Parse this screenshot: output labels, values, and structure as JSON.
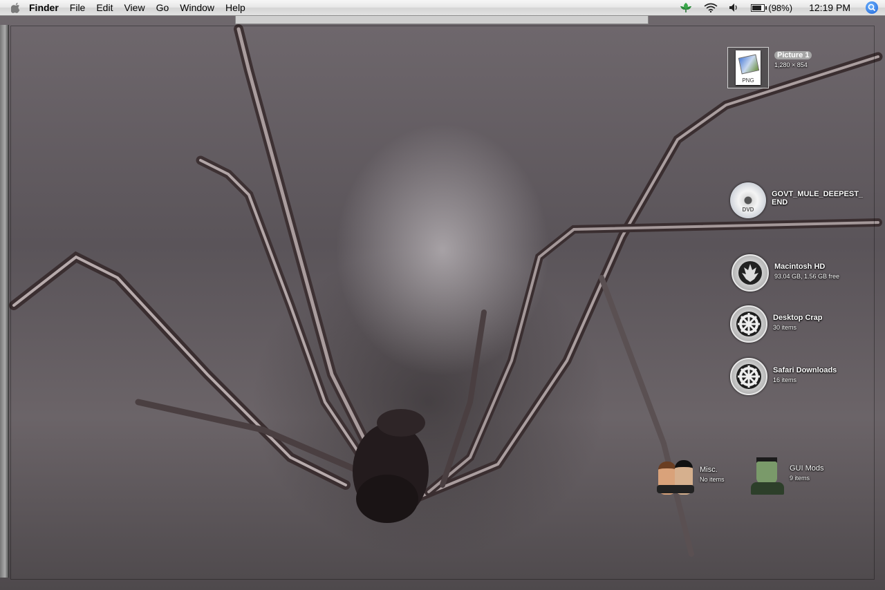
{
  "menubar": {
    "app_name": "Finder",
    "menus": [
      "File",
      "Edit",
      "View",
      "Go",
      "Window",
      "Help"
    ],
    "battery_text": "(98%)",
    "clock": "12:19 PM"
  },
  "desktop": {
    "icons": [
      {
        "name": "Picture 1",
        "info": "1,280 × 854",
        "badge": "PNG",
        "icon": "png-file-icon"
      },
      {
        "name": "GOVT_MULE_DEEPEST_\nEND",
        "info": "",
        "badge": "DVD",
        "icon": "dvd-disc-icon"
      },
      {
        "name": "Macintosh HD",
        "info": "93.04 GB, 1.56 GB free",
        "icon": "rebel-alliance-drive-icon"
      },
      {
        "name": "Desktop Crap",
        "info": "30 items",
        "icon": "imperial-emblem-folder-icon"
      },
      {
        "name": "Safari Downloads",
        "info": "16 items",
        "icon": "imperial-emblem-folder-icon"
      },
      {
        "name": "Misc.",
        "info": "No items",
        "icon": "kirk-spock-folder-icon"
      },
      {
        "name": "GUI Mods",
        "info": "9 items",
        "icon": "frankenstein-folder-icon"
      }
    ]
  }
}
